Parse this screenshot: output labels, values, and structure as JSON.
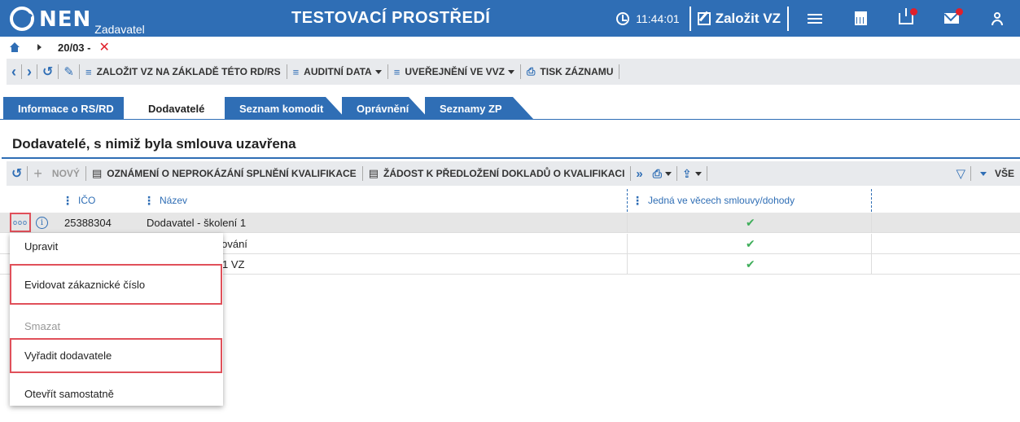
{
  "header": {
    "logo_text": "NEN",
    "logo_sub": "Zadavatel",
    "env_title": "TESTOVACÍ PROSTŘEDÍ",
    "time": "11:44:01",
    "create_label": "Založit VZ"
  },
  "breadcrumb": {
    "item": "20/03 -"
  },
  "actionbar": {
    "create_based": "ZALOŽIT VZ NA ZÁKLADĚ TÉTO RD/RS",
    "audit": "AUDITNÍ DATA",
    "publish": "UVEŘEJNĚNÍ VE VVZ",
    "print": "TISK ZÁZNAMU"
  },
  "tabs": [
    "Informace o RS/RD",
    "Dodavatelé",
    "Seznam komodit",
    "Oprávnění",
    "Seznamy ZP"
  ],
  "section": {
    "title": "Dodavatelé, s nimiž byla smlouva uzavřena"
  },
  "gridbar": {
    "new": "NOVÝ",
    "notice": "OZNÁMENÍ O NEPROKÁZÁNÍ SPLNĚNÍ KVALIFIKACE",
    "request": "ŽÁDOST K PŘEDLOŽENÍ DOKLADŮ O KVALIFIKACI",
    "all": "VŠE"
  },
  "table": {
    "columns": [
      "IČO",
      "Název",
      "Jedná ve věcech smlouvy/dohody"
    ],
    "rows": [
      {
        "ico": "25388304",
        "name": "Dodavatel - školení 1",
        "check": "✔"
      },
      {
        "ico": "",
        "name": "stování",
        "check": "✔"
      },
      {
        "ico": "",
        "name": "1 VZ",
        "check": "✔"
      }
    ]
  },
  "context_menu": {
    "edit": "Upravit",
    "register": "Evidovat zákaznické číslo",
    "delete": "Smazat",
    "remove": "Vyřadit dodavatele",
    "open": "Otevřít samostatně"
  }
}
